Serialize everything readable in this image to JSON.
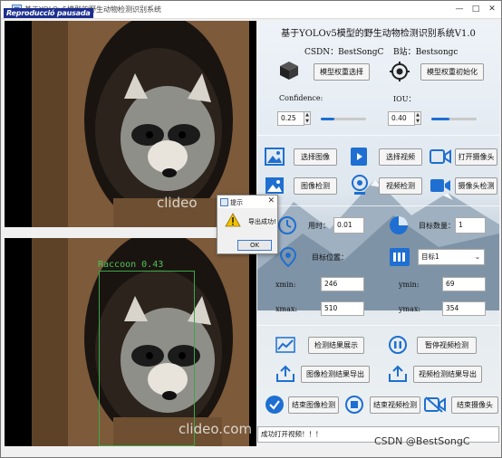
{
  "window": {
    "title": "基于YOLOv5模型的野生动物检测识别系统",
    "repro_badge": "Reproducció pausada",
    "minimize": "—",
    "maximize": "□",
    "close": "✕"
  },
  "left": {
    "watermark_top": "clideo",
    "watermark_bottom": "clideo.com",
    "detection_label": "Raccoon 0.43"
  },
  "header": {
    "system_title": "基于YOLOv5模型的野生动物检测识别系统V1.0",
    "csdn": "CSDN：BestSongC",
    "bilibili": "B站：Bestsongc"
  },
  "model": {
    "select_weights": "模型权重选择",
    "init_weights": "模型权重初始化",
    "confidence_label": "Confidence:",
    "confidence_value": "0.25",
    "confidence_level": 0.3,
    "iou_label": "IOU：",
    "iou_value": "0.40",
    "iou_level": 0.4
  },
  "input": {
    "select_image": "选择图像",
    "select_video": "选择视频",
    "open_camera": "打开摄像头",
    "image_detect": "图像检测",
    "video_detect": "视频检测",
    "camera_detect": "摄像头检测"
  },
  "results": {
    "time_label": "用时：",
    "time_value": "0.01",
    "count_label": "目标数量：",
    "count_value": "1",
    "position_label": "目标位置：",
    "target_select": "目标1",
    "xmin_label": "xmin:",
    "xmin_value": "246",
    "ymin_label": "ymin:",
    "ymin_value": "69",
    "xmax_label": "xmax:",
    "xmax_value": "510",
    "ymax_label": "ymax:",
    "ymax_value": "354"
  },
  "actions": {
    "show_results": "检测结果展示",
    "pause_video": "暂停视频检测",
    "export_image": "图像检测结果导出",
    "export_video": "视频检测结果导出",
    "end_image": "结束图像检测",
    "end_video": "结束视频检测",
    "end_camera": "结束摄像头"
  },
  "status": {
    "message": "成功打开视频！！！"
  },
  "dialog": {
    "title": "提示",
    "message": "导出成功!",
    "ok": "OK",
    "close": "✕"
  },
  "footer": {
    "csdn_watermark": "CSDN @BestSongC"
  },
  "colors": {
    "accent_blue": "#1e6fd1",
    "detection_green": "#3aa84a"
  }
}
